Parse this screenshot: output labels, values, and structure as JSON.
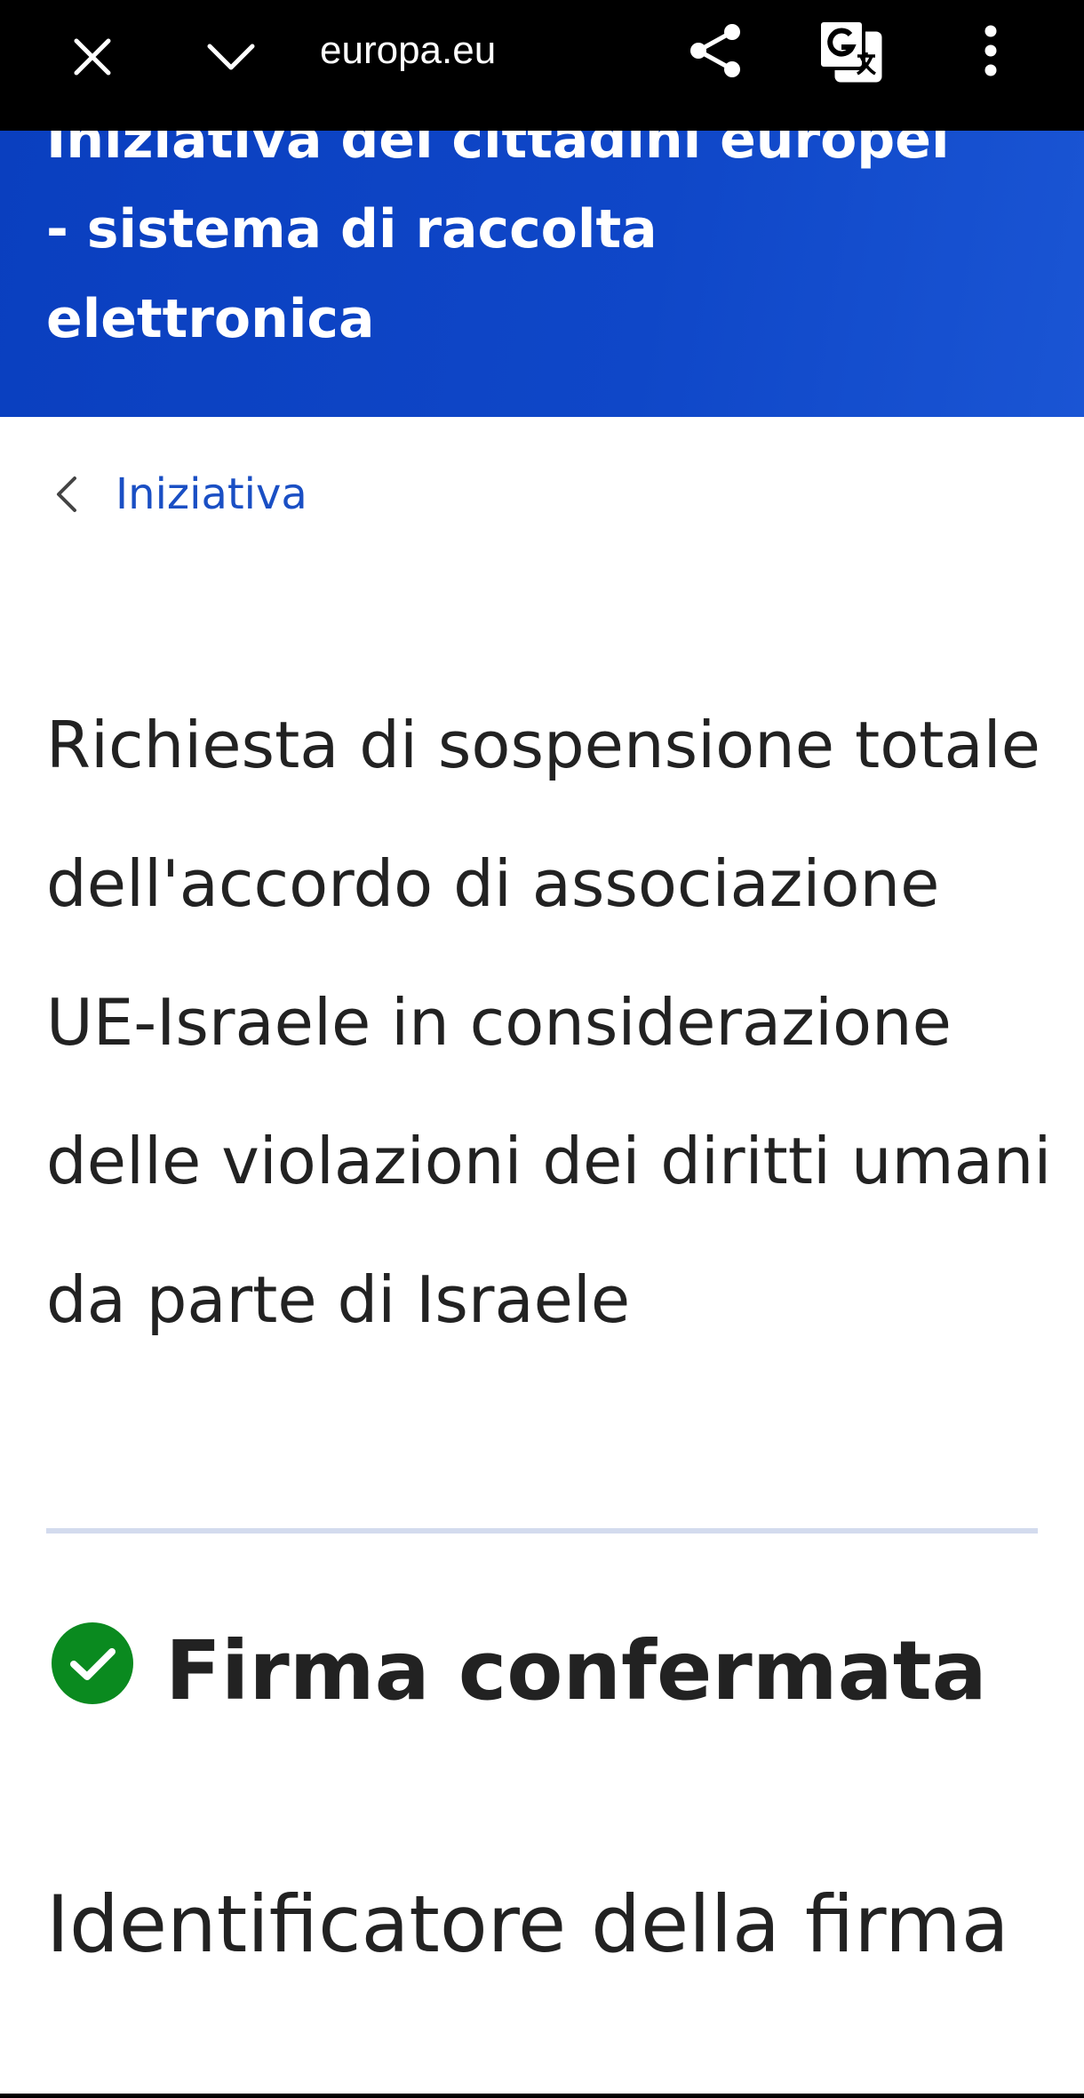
{
  "browser": {
    "url": "europa.eu",
    "icons": [
      "close-icon",
      "chevron-down-icon",
      "share-icon",
      "translate-icon",
      "more-vert-icon"
    ]
  },
  "banner": {
    "title_lines": [
      "Iniziativa dei cittadini europei",
      "- sistema di raccolta",
      "elettronica"
    ],
    "color": "#0f47c8"
  },
  "navigation": {
    "back_label": "Iniziativa"
  },
  "initiative": {
    "title": "Richiesta di sospensione totale dell'accordo di associazione UE-Israele in considerazione delle violazioni dei diritti umani da parte di Israele"
  },
  "status": {
    "label": "Firma confermata",
    "icon": "check-circle-icon",
    "color": "#0a8a1f"
  },
  "signature_section": {
    "heading": "Identificatore della firma"
  }
}
